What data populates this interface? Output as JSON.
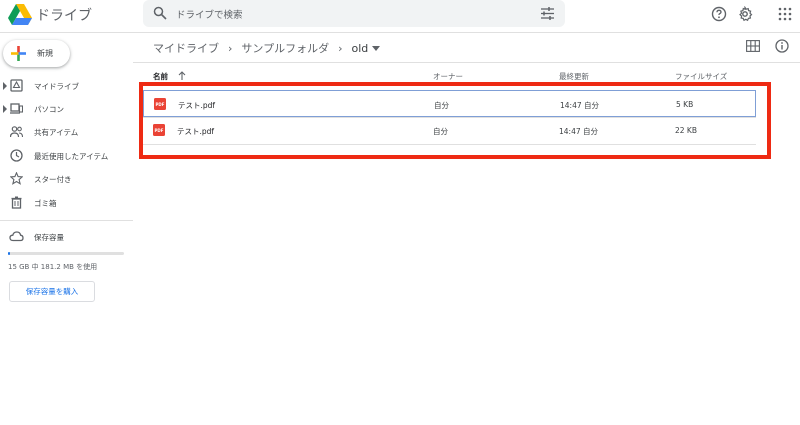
{
  "app": {
    "title": "ドライブ"
  },
  "search": {
    "placeholder": "ドライブで検索"
  },
  "sidebar": {
    "new_label": "新規",
    "items": [
      {
        "label": "マイドライブ"
      },
      {
        "label": "パソコン"
      },
      {
        "label": "共有アイテム"
      },
      {
        "label": "最近使用したアイテム"
      },
      {
        "label": "スター付き"
      },
      {
        "label": "ゴミ箱"
      }
    ],
    "storage": {
      "label": "保存容量",
      "usage_text": "15 GB 中 181.2 MB を使用",
      "used_fraction": 0.012,
      "buy_label": "保存容量を購入"
    }
  },
  "breadcrumb": {
    "items": [
      "マイドライブ",
      "サンプルフォルダ",
      "old"
    ]
  },
  "table": {
    "headers": {
      "name": "名前",
      "owner": "オーナー",
      "modified": "最終更新",
      "size": "ファイルサイズ"
    },
    "rows": [
      {
        "name": "テスト.pdf",
        "owner": "自分",
        "modified": "14:47 自分",
        "size": "5 KB",
        "selected": true
      },
      {
        "name": "テスト.pdf",
        "owner": "自分",
        "modified": "14:47 自分",
        "size": "22 KB",
        "selected": false
      }
    ]
  },
  "colors": {
    "accent": "#1a73e8",
    "highlight": "#ee2a13",
    "pdf": "#ea4335"
  }
}
